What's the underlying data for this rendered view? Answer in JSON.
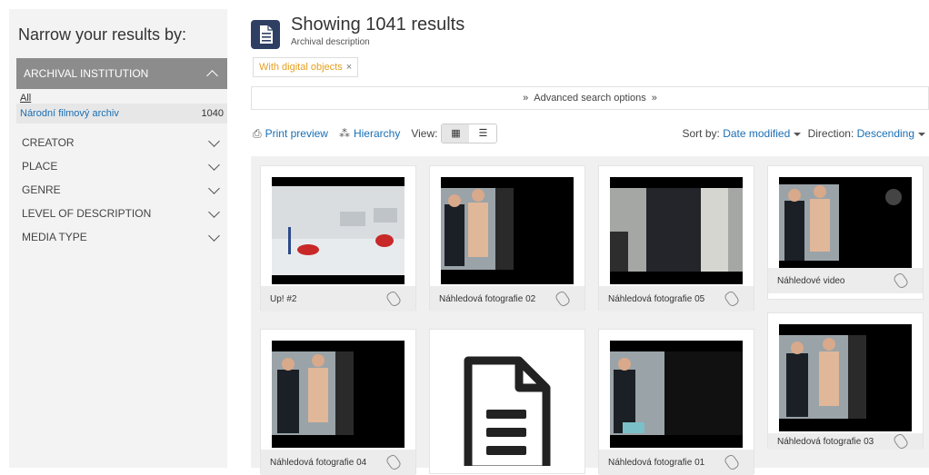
{
  "sidebar": {
    "title": "Narrow your results by:",
    "facet_open": {
      "label": "ARCHIVAL INSTITUTION",
      "all_label": "All",
      "items": [
        {
          "label": "Národní filmový archiv",
          "count": "1040"
        }
      ]
    },
    "facets": [
      "CREATOR",
      "PLACE",
      "GENRE",
      "LEVEL OF DESCRIPTION",
      "MEDIA TYPE"
    ]
  },
  "header": {
    "title": "Showing 1041 results",
    "subtitle": "Archival description"
  },
  "filter": {
    "label": "With digital objects",
    "remove": "×"
  },
  "advanced": {
    "label": "Advanced search options"
  },
  "toolbar": {
    "print": "Print preview",
    "hierarchy": "Hierarchy",
    "view_label": "View:",
    "sort_label": "Sort by:",
    "sort_value": "Date modified",
    "direction_label": "Direction:",
    "direction_value": "Descending"
  },
  "cards": [
    {
      "caption": "Up! #2",
      "icon": "video-frame-room"
    },
    {
      "caption": "Náhledová fotografie 02",
      "icon": "video-frame"
    },
    {
      "caption": "Náhledová fotografie 05",
      "icon": "video-frame"
    },
    {
      "caption": "Náhledové video",
      "icon": "video-frame"
    },
    {
      "caption": "Náhledová fotografie 04",
      "icon": "video-frame"
    },
    {
      "caption": "",
      "icon": "document-icon"
    },
    {
      "caption": "Náhledová fotografie 01",
      "icon": "video-frame"
    },
    {
      "caption": "Náhledová fotografie 03",
      "icon": "video-frame"
    }
  ]
}
